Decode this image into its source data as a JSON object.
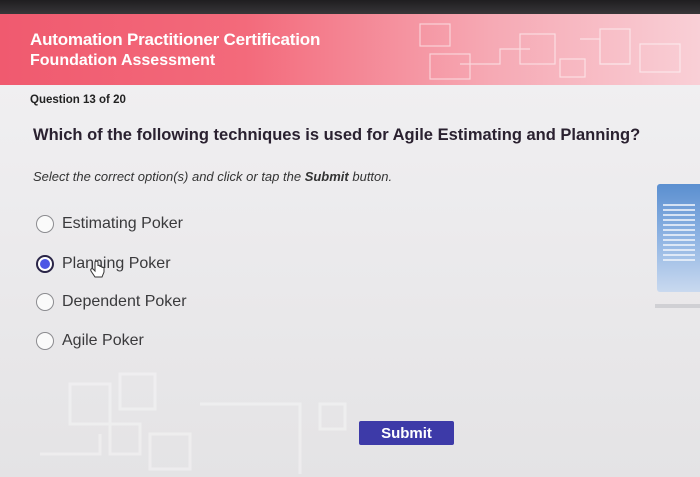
{
  "header": {
    "title": "Automation Practitioner Certification",
    "subtitle": "Foundation Assessment"
  },
  "progress": {
    "label": "Question 13 of 20",
    "current": 13,
    "total": 20
  },
  "question": {
    "text": "Which of the following techniques is used for Agile Estimating and Planning?",
    "instruction_prefix": "Select the correct option(s) and click or tap the ",
    "instruction_bold": "Submit",
    "instruction_suffix": " button."
  },
  "options": [
    {
      "label": "Estimating Poker",
      "selected": false
    },
    {
      "label": "Planning Poker",
      "selected": true
    },
    {
      "label": "Dependent Poker",
      "selected": false
    },
    {
      "label": "Agile Poker",
      "selected": false
    }
  ],
  "actions": {
    "submit_label": "Submit"
  },
  "colors": {
    "header_accent": "#f05a6f",
    "submit_bg": "#3d3aa8",
    "radio_selected": "#4d57e5"
  },
  "icons": {
    "radio_unselected": "radio-empty-icon",
    "radio_selected": "radio-filled-icon",
    "pointer": "hand-pointer-icon"
  }
}
